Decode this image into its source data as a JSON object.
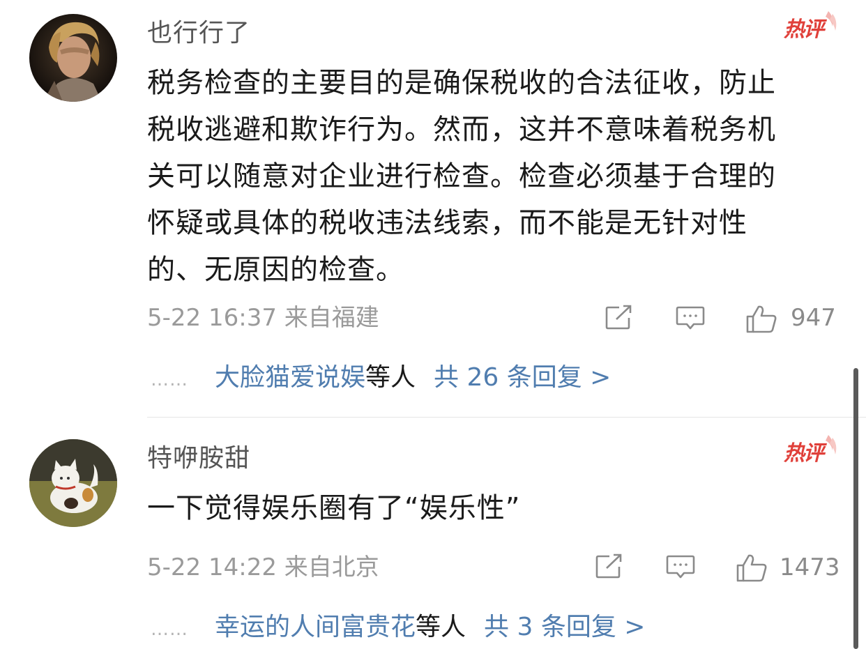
{
  "comments": [
    {
      "username": "也行行了",
      "badge": "热评",
      "content_lines": [
        "税务检查的主要目的是确保税收的合法征收，防止",
        "税收逃避和欺诈行为。然而，这并不意味着税务机",
        "关可以随意对企业进行检查。检查必须基于合理的",
        "怀疑或具体的税收违法线索，而不能是无针对性",
        "的、无原因的检查。"
      ],
      "time": "5-22 16:37",
      "location": "来自福建",
      "likes": "947",
      "replies": {
        "dots": "……",
        "users": "大脸猫爱说娱",
        "suffix": "等人",
        "count_text": "共 26 条回复 >"
      }
    },
    {
      "username": "特咿胺甜",
      "badge": "热评",
      "content_lines": [
        "一下觉得娱乐圈有了“娱乐性”"
      ],
      "time": "5-22 14:22",
      "location": "来自北京",
      "likes": "1473",
      "replies": {
        "dots": "……",
        "users": "幸运的人间富贵花",
        "suffix": "等人",
        "count_text": "共 3 条回复 >"
      }
    }
  ],
  "icons": {
    "share": "share-icon",
    "comment": "comment-icon",
    "like": "thumbs-up-icon",
    "hot": "hot-comment-badge"
  },
  "colors": {
    "link": "#507daf",
    "meta": "#9a9a9a",
    "hot": "#e0403a"
  }
}
